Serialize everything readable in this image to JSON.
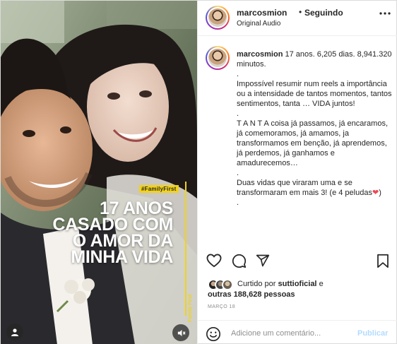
{
  "post": {
    "username": "marcosmion",
    "follow_state": "Seguindo",
    "audio": "Original Audio",
    "separator": "•"
  },
  "media": {
    "hashtag": "#FamilyFirst",
    "overlay_lines": [
      "17 ANOS",
      "CASADO COM",
      "O AMOR DA",
      "MINHA VIDA"
    ],
    "vertical_brand": "Family First",
    "accent_color": "#f2d21a"
  },
  "caption": {
    "username": "marcosmion",
    "first_line": "17 anos. 6,205 dias. 8,941.320 minutos.",
    "dot1": ".",
    "para1": "Impossível resumir num reels a importância ou a intensidade de tantos momentos, tantos sentimentos, tanta … VIDA juntos!",
    "dot2": ".",
    "para2": "T A N T A coisa já passamos, já encaramos, já comemoramos, já amamos, ja transformamos em benção, já aprendemos, já perdemos, já ganhamos e amadurecemos…",
    "dot3": ".",
    "para3": "Duas vidas que viraram uma e se transformaram em mais 3! (e 4 peludas",
    "heart": "❤",
    "para3_end": ")",
    "dot4": "."
  },
  "actions": {
    "like_icon": "heart-outline-icon",
    "comment_icon": "comment-bubble-icon",
    "share_icon": "paper-plane-icon",
    "save_icon": "bookmark-icon"
  },
  "likes": {
    "prefix": "Curtido por",
    "first_user": "suttioficial",
    "conj": "e",
    "others": "outras 188,628 pessoas"
  },
  "date": "MARÇO 18",
  "comment_box": {
    "placeholder": "Adicione um comentário...",
    "publish_label": "Publicar"
  },
  "colors": {
    "publish_disabled": "#b3dbff",
    "heart": "#ed4956",
    "muted": "#8e8e8e"
  }
}
